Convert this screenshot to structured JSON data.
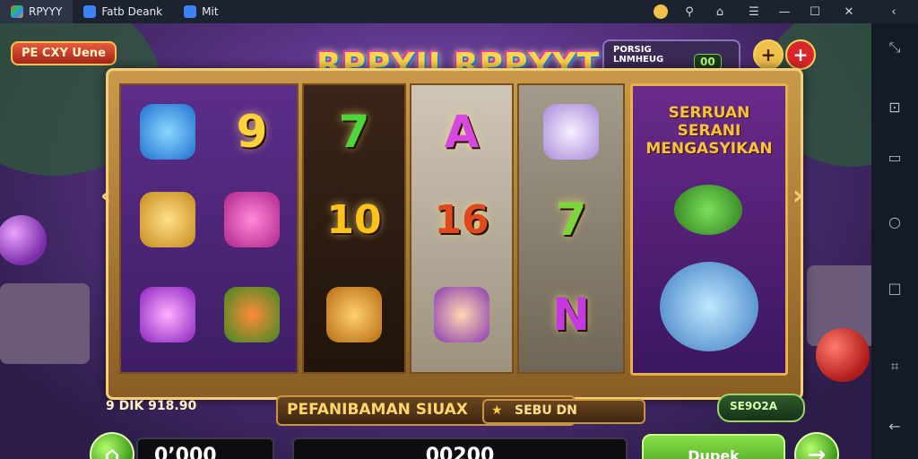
{
  "tabs": [
    {
      "label": "RPYYY",
      "icon": "multi-app-icon"
    },
    {
      "label": "Fatb Deank",
      "icon": "app-icon"
    },
    {
      "label": "Mit",
      "icon": "app-icon"
    }
  ],
  "window_controls": [
    "coin-icon",
    "search-icon",
    "phone-icon",
    "menu-icon",
    "minimize-icon",
    "maximize-icon",
    "close-icon",
    "back-icon"
  ],
  "side_tools": [
    "expand-icon",
    "resize-icon",
    "screen-icon",
    "circle-icon",
    "square-icon",
    "screenshot-icon",
    "back-arrow-icon"
  ],
  "game": {
    "top_badge": "PE CXY Uene",
    "logo": "RPPYII RPPYYT",
    "balance_label": "PORSIG LNMHEUG",
    "balance_value": "00",
    "add_button": "+",
    "bet_plus_button": "+",
    "promo_title": "SERRUAN SERANI MENGASYIKAN",
    "reels": [
      {
        "symbols": [
          "blue-creature",
          "9",
          "gem-creature"
        ]
      },
      {
        "symbols": [
          "7",
          "10",
          "scroll"
        ]
      },
      {
        "symbols": [
          "A",
          "16",
          "mouse"
        ]
      },
      {
        "symbols": [
          "cloud",
          "7",
          "N"
        ]
      }
    ],
    "info": {
      "win_label": "9 DIK 918.90",
      "title": "PEFANIBAMAN SIUAX",
      "mode_label": "SEBU DN",
      "bonus_label": "SE9O2A"
    },
    "bottom": {
      "total_label": "0’000",
      "bet_label": "00200",
      "spin_label": "Dupek"
    }
  }
}
